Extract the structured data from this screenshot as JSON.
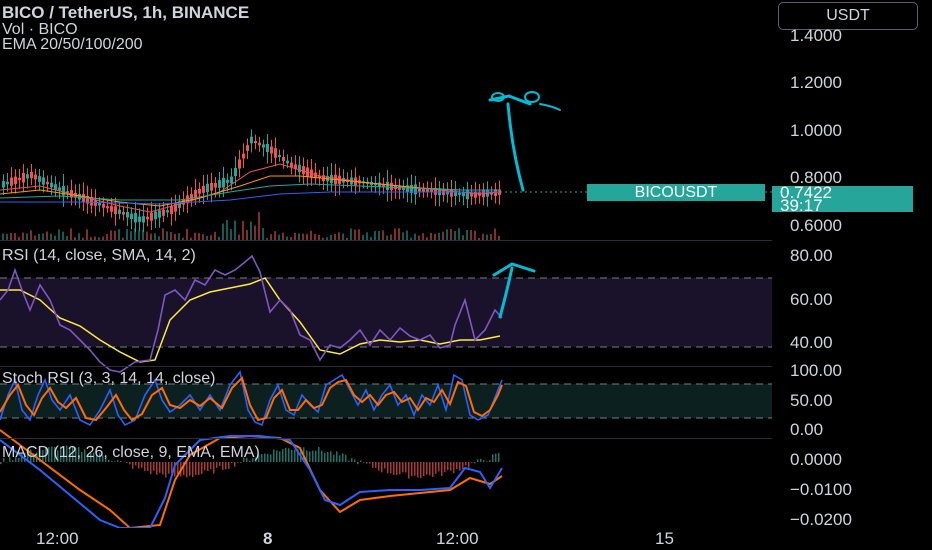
{
  "header": {
    "title": "BICO / TetherUS, 1h, BINANCE",
    "volume": "Vol · BICO",
    "ema": "EMA 20/50/100/200"
  },
  "price_scale": {
    "currency": "USDT",
    "labels": [
      "1.4000",
      "1.2000",
      "1.0000",
      "0.8000",
      "0.6000"
    ],
    "last_price": "0.7422",
    "countdown": "39:17",
    "symbol": "BICOUSDT"
  },
  "rsi": {
    "title": "RSI (14, close, SMA, 14, 2)",
    "labels": [
      "80.00",
      "60.00",
      "40.00"
    ]
  },
  "stoch": {
    "title": "Stoch RSI (3, 3, 14, 14, close)",
    "labels": [
      "100.00",
      "50.00",
      "0.00"
    ]
  },
  "macd": {
    "title": "MACD (12, 26, close, 9, EMA, EMA)",
    "labels": [
      "0.0000",
      "−0.0100",
      "−0.0200"
    ]
  },
  "time_axis": {
    "ticks": [
      "12:00",
      "8",
      "12:00",
      "15"
    ]
  },
  "colors": {
    "up": "#26a69a",
    "down": "#ef5350",
    "rsi": "#7e57c2",
    "sma": "#ffeb3b",
    "macd": "#2962ff",
    "signal": "#ff6d00",
    "annotation": "#00bcd4"
  }
}
